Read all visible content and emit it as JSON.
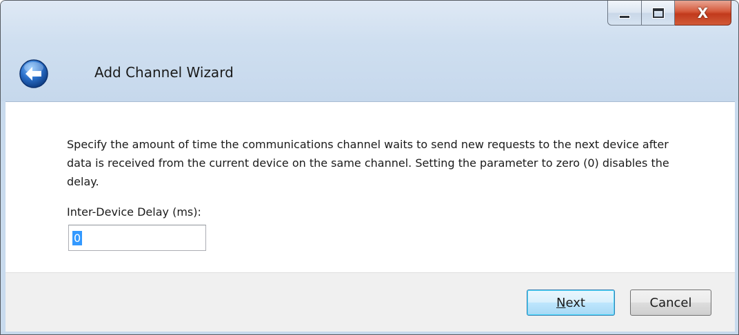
{
  "window": {
    "caption_buttons": {
      "minimize_icon": "minimize-icon",
      "maximize_icon": "maximize-icon",
      "close_glyph": "X"
    }
  },
  "header": {
    "back_icon": "back-arrow-icon",
    "title": "Add Channel Wizard"
  },
  "main": {
    "description": "Specify the amount of time the communications channel waits to send new requests to the next device after data is received from the current device on the same channel. Setting the parameter to zero (0) disables the delay.",
    "field_label": "Inter-Device Delay (ms):",
    "field_value": "0"
  },
  "footer": {
    "next_mnemonic": "N",
    "next_rest": "ext",
    "cancel_label": "Cancel"
  },
  "colors": {
    "accent": "#3399ff",
    "back_button": "#2a6fc9",
    "close_button": "#c23a1c"
  }
}
